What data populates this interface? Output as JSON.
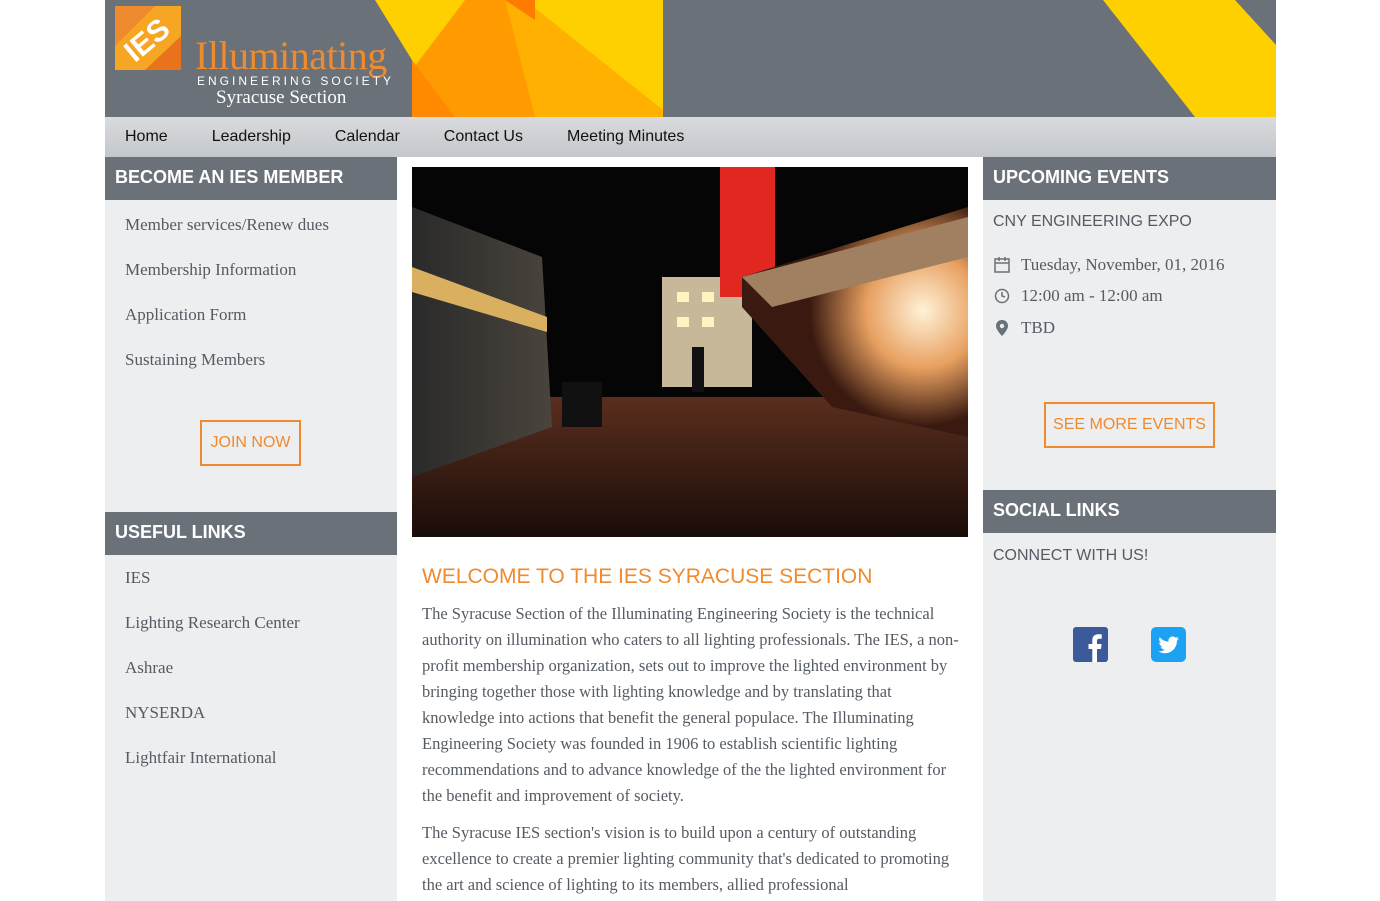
{
  "colors": {
    "accent": "#f08a2e",
    "header_gray": "#6b7179",
    "panel_gray": "#eceef0",
    "yellow": "#ffd000",
    "facebook": "#3b5a9a",
    "twitter": "#1da1f2"
  },
  "header": {
    "logo_mark_text": "IES",
    "logo_title": "Illuminating",
    "logo_subtitle": "ENGINEERING SOCIETY",
    "logo_section": "Syracuse Section"
  },
  "nav": {
    "items": [
      "Home",
      "Leadership",
      "Calendar",
      "Contact Us",
      "Meeting Minutes"
    ]
  },
  "left": {
    "member_heading": "BECOME AN IES MEMBER",
    "member_links": [
      "Member services/Renew dues",
      "Membership Information",
      "Application Form",
      "Sustaining Members"
    ],
    "join_label": "JOIN NOW",
    "useful_heading": "USEFUL LINKS",
    "useful_links": [
      "IES",
      "Lighting Research Center",
      "Ashrae",
      "NYSERDA",
      "Lightfair International"
    ]
  },
  "main": {
    "welcome_title": "WELCOME TO THE IES SYRACUSE SECTION",
    "para1": "The Syracuse Section of the Illuminating Engineering Society is the technical authority on illumination who caters to all lighting professionals. The IES, a non-profit membership organization, sets out to improve the lighted environment by bringing together those with lighting knowledge and by translating that knowledge into actions that benefit the general populace. The Illuminating Engineering Society was founded in 1906 to establish scientific lighting recommendations and to advance knowledge of the the lighted environment for the benefit and improvement of society.",
    "para2": "The Syracuse IES section's vision is to build upon a century of outstanding excellence to create a premier lighting community that's dedicated to promoting the art and science of lighting to its members, allied professional"
  },
  "right": {
    "events_heading": "UPCOMING EVENTS",
    "event_name": "CNY ENGINEERING EXPO",
    "event_date": "Tuesday, November, 01, 2016",
    "event_time": "12:00 am - 12:00 am",
    "event_location": "TBD",
    "more_label": "SEE MORE EVENTS",
    "social_heading": "SOCIAL LINKS",
    "connect_text": "CONNECT WITH US!",
    "icons": [
      "calendar-icon",
      "clock-icon",
      "map-pin-icon",
      "facebook-icon",
      "twitter-icon"
    ]
  }
}
